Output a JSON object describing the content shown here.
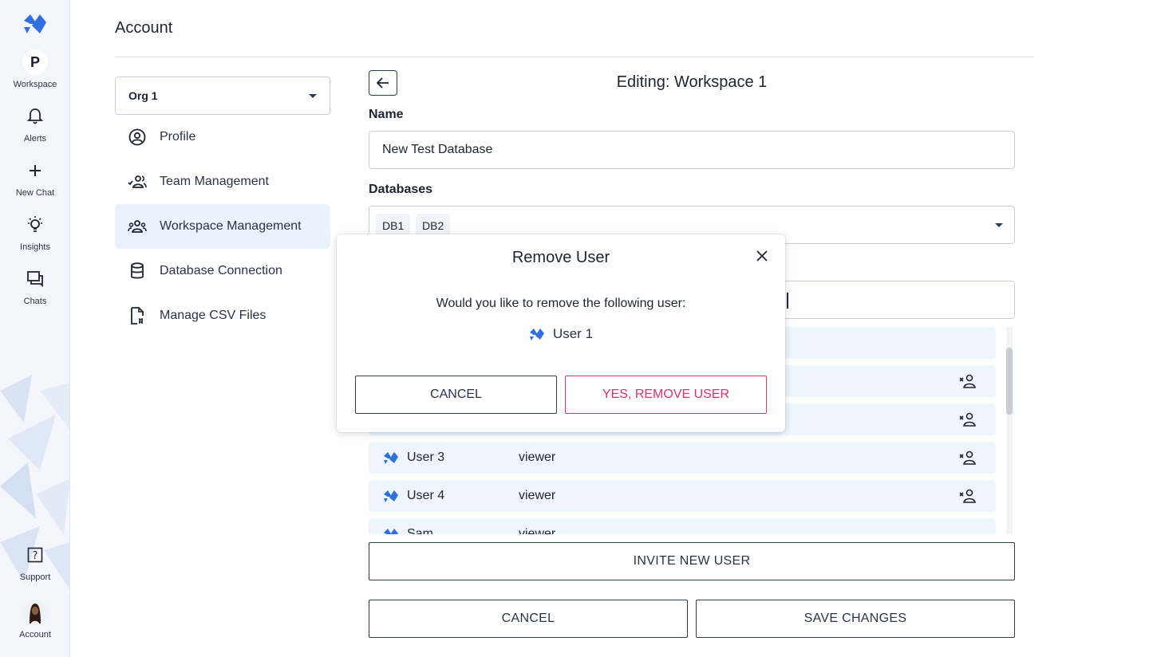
{
  "rail": {
    "items": [
      {
        "label": "Workspace",
        "initial": "P",
        "icon": "workspace-avatar"
      },
      {
        "label": "Alerts",
        "icon": "bell-icon"
      },
      {
        "label": "New Chat",
        "icon": "plus-icon"
      },
      {
        "label": "Insights",
        "icon": "lightbulb-icon"
      },
      {
        "label": "Chats",
        "icon": "chat-bubbles-icon"
      }
    ],
    "bottom": [
      {
        "label": "Support",
        "icon": "help-icon"
      },
      {
        "label": "Account",
        "icon": "user-avatar"
      }
    ]
  },
  "header": {
    "title": "Account"
  },
  "org_select": {
    "value": "Org 1"
  },
  "menu": {
    "items": [
      {
        "label": "Profile",
        "icon": "user-circle-icon",
        "active": false
      },
      {
        "label": "Team Management",
        "icon": "team-check-icon",
        "active": false
      },
      {
        "label": "Workspace Management",
        "icon": "group-icon",
        "active": true
      },
      {
        "label": "Database Connection",
        "icon": "database-icon",
        "active": false
      },
      {
        "label": "Manage CSV Files",
        "icon": "csv-file-icon",
        "active": false
      }
    ]
  },
  "editor": {
    "title": "Editing: Workspace 1",
    "name_label": "Name",
    "name_value": "New Test Database",
    "databases_label": "Databases",
    "databases": [
      "DB1",
      "DB2"
    ],
    "users": [
      {
        "name": "User 3",
        "role": "viewer"
      },
      {
        "name": "User 4",
        "role": "viewer"
      },
      {
        "name": "Sam",
        "role": "viewer"
      }
    ],
    "invite_label": "INVITE NEW USER",
    "cancel_label": "CANCEL",
    "save_label": "SAVE CHANGES"
  },
  "modal": {
    "title": "Remove User",
    "message": "Would you like to remove the following user:",
    "user": "User 1",
    "cancel_label": "CANCEL",
    "confirm_label": "YES, REMOVE USER"
  },
  "colors": {
    "accent": "#2f6fe0",
    "danger": "#e0326e",
    "row_bg": "#eef5fd",
    "active_menu_bg": "#eaf3fd"
  }
}
